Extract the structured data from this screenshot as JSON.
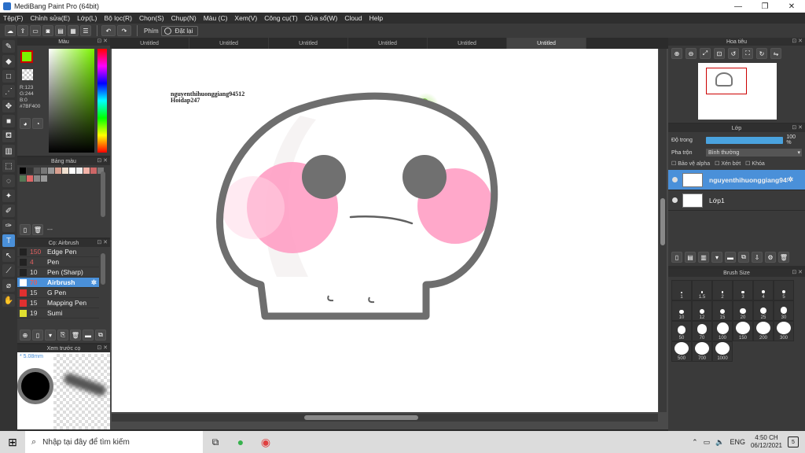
{
  "window": {
    "title": "MediBang Paint Pro (64bit)",
    "controls": [
      "—",
      "❐",
      "✕"
    ]
  },
  "menu": [
    "Tệp(F)",
    "Chỉnh sửa(E)",
    "Lớp(L)",
    "Bộ lọc(R)",
    "Chọn(S)",
    "Chụp(N)",
    "Màu (C)",
    "Xem(V)",
    "Công cụ(T)",
    "Cửa sổ(W)",
    "Cloud",
    "Help"
  ],
  "toolbar": {
    "keys_label": "Phím",
    "reset_label": "Đặt lại"
  },
  "tabs": [
    "Untitled",
    "Untitled",
    "Untitled",
    "Untitled",
    "Untitled",
    "Untitled"
  ],
  "color_panel": {
    "title": "Màu",
    "r": "R:123",
    "g": "G:244",
    "b": "B:0",
    "hex": "#7BF400",
    "fg_color": "#7BF400"
  },
  "palette_panel": {
    "title": "Bảng màu",
    "footer": "---",
    "colors": [
      "#000000",
      "#333333",
      "#555555",
      "#777777",
      "#999999",
      "#d9a090",
      "#f0e0d0",
      "#ffffff",
      "#eeeeee",
      "#f2b3a8",
      "#cc6666",
      "#777777",
      "#557755",
      "#e06666",
      "#888888",
      "#999999"
    ]
  },
  "brush_panel": {
    "title": "Cọ: Airbrush",
    "items": [
      {
        "size": "150",
        "name": "Edge Pen",
        "color": "#222222"
      },
      {
        "size": "4",
        "name": "Pen",
        "color": "#222222"
      },
      {
        "size": "10",
        "name": "Pen (Sharp)",
        "color": "#222222"
      },
      {
        "size": "70",
        "name": "Airbrush",
        "color": "#ffffff"
      },
      {
        "size": "15",
        "name": "G Pen",
        "color": "#e03030"
      },
      {
        "size": "15",
        "name": "Mapping Pen",
        "color": "#e03030"
      },
      {
        "size": "19",
        "name": "Sumi",
        "color": "#e0e030"
      }
    ]
  },
  "preview_panel": {
    "title": "Xem trước cọ",
    "size": "5.08mm"
  },
  "canvas": {
    "signature_line1": "nguyenthihuonggiang94512",
    "signature_line2": "Hoidap247"
  },
  "navigator_panel": {
    "title": "Hoa tiêu"
  },
  "layer_panel": {
    "title": "Lớp",
    "opacity_label": "Độ trong",
    "opacity_value": "100 %",
    "blend_label": "Pha trộn",
    "blend_value": "Bình thường",
    "protect_alpha": "Bảo vệ alpha",
    "clipping": "Xén bớt",
    "lock": "Khóa",
    "layers": [
      {
        "name": "nguyenthihuonggiang94512"
      },
      {
        "name": "Lớp1"
      }
    ]
  },
  "brush_size_panel": {
    "title": "Brush Size",
    "sizes": [
      "1",
      "1.5",
      "2",
      "3",
      "4",
      "5",
      "10",
      "12",
      "15",
      "20",
      "25",
      "30",
      "50",
      "70",
      "100",
      "150",
      "200",
      "300",
      "500",
      "700",
      "1000"
    ]
  },
  "taskbar": {
    "search_placeholder": "Nhập tại đây để tìm kiếm",
    "lang": "ENG",
    "time": "4:50 CH",
    "date": "06/12/2021",
    "notif_count": "5"
  }
}
